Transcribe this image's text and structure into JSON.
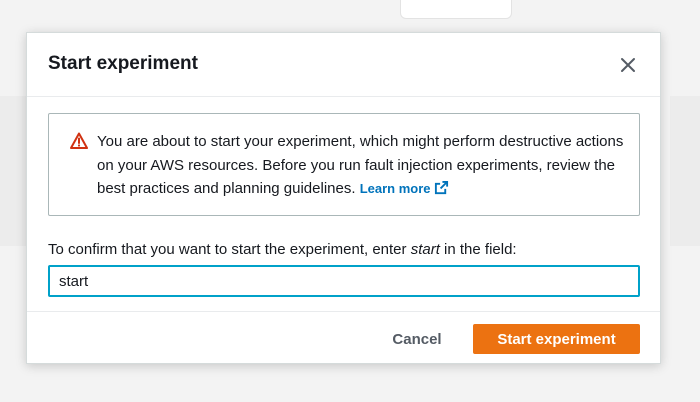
{
  "modal": {
    "title": "Start experiment",
    "close_icon": "close-icon"
  },
  "alert": {
    "icon": "warning-triangle-icon",
    "icon_color": "#d13212",
    "message": "You are about to start your experiment, which might perform destructive actions on your AWS resources. Before you run fault injection experiments, review the best practices and planning guidelines.",
    "link_label": "Learn more",
    "link_icon": "external-link-icon",
    "link_color": "#0073bb"
  },
  "confirm": {
    "label_prefix": "To confirm that you want to start the experiment, enter",
    "label_keyword": "start",
    "label_suffix": "in the field:",
    "input_value": "start",
    "input_border_color": "#00a1c9"
  },
  "footer": {
    "cancel_label": "Cancel",
    "start_label": "Start experiment",
    "primary_color": "#ec7211"
  }
}
